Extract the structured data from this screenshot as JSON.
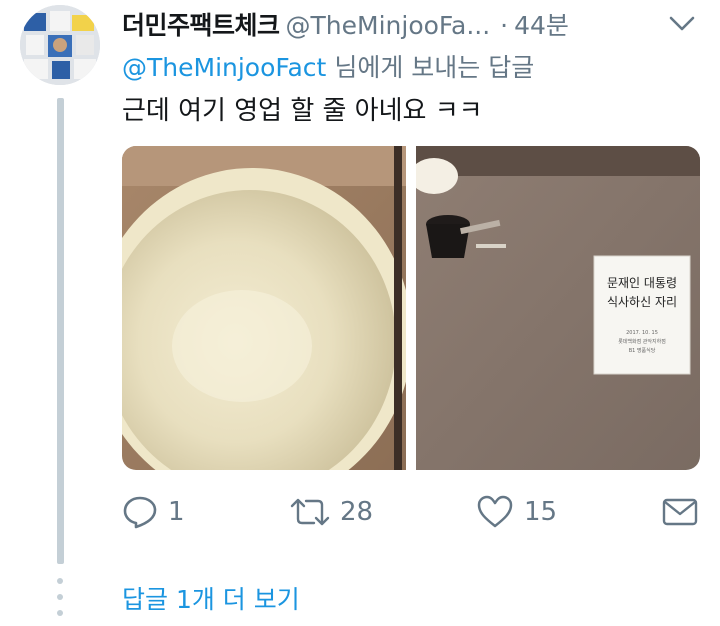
{
  "tweet": {
    "display_name": "더민주팩트체크",
    "handle": "@TheMinjooFa...",
    "separator": "·",
    "time": "44분",
    "replying_mention": "@TheMinjooFact",
    "replying_suffix": "님에게 보내는 답글",
    "text": "근데 여기 영업 할 줄 아네요 ㅋㅋ",
    "media": {
      "left_alt": "bowl-photo",
      "right_alt": "table-sign-photo",
      "sign_line1": "문재인 대통령",
      "sign_line2": "식사하신 자리",
      "sign_small1": "2017. 10. 15",
      "sign_small2": "롯데백화점 관악지하점",
      "sign_small3": "B1 명품식당"
    },
    "actions": {
      "replies": "1",
      "retweets": "28",
      "likes": "15"
    }
  },
  "thread": {
    "more_replies": "답글 1개 더 보기"
  },
  "colors": {
    "accent": "#1b95e0",
    "secondary": "#657786",
    "thread_line": "#c4cfd6"
  }
}
